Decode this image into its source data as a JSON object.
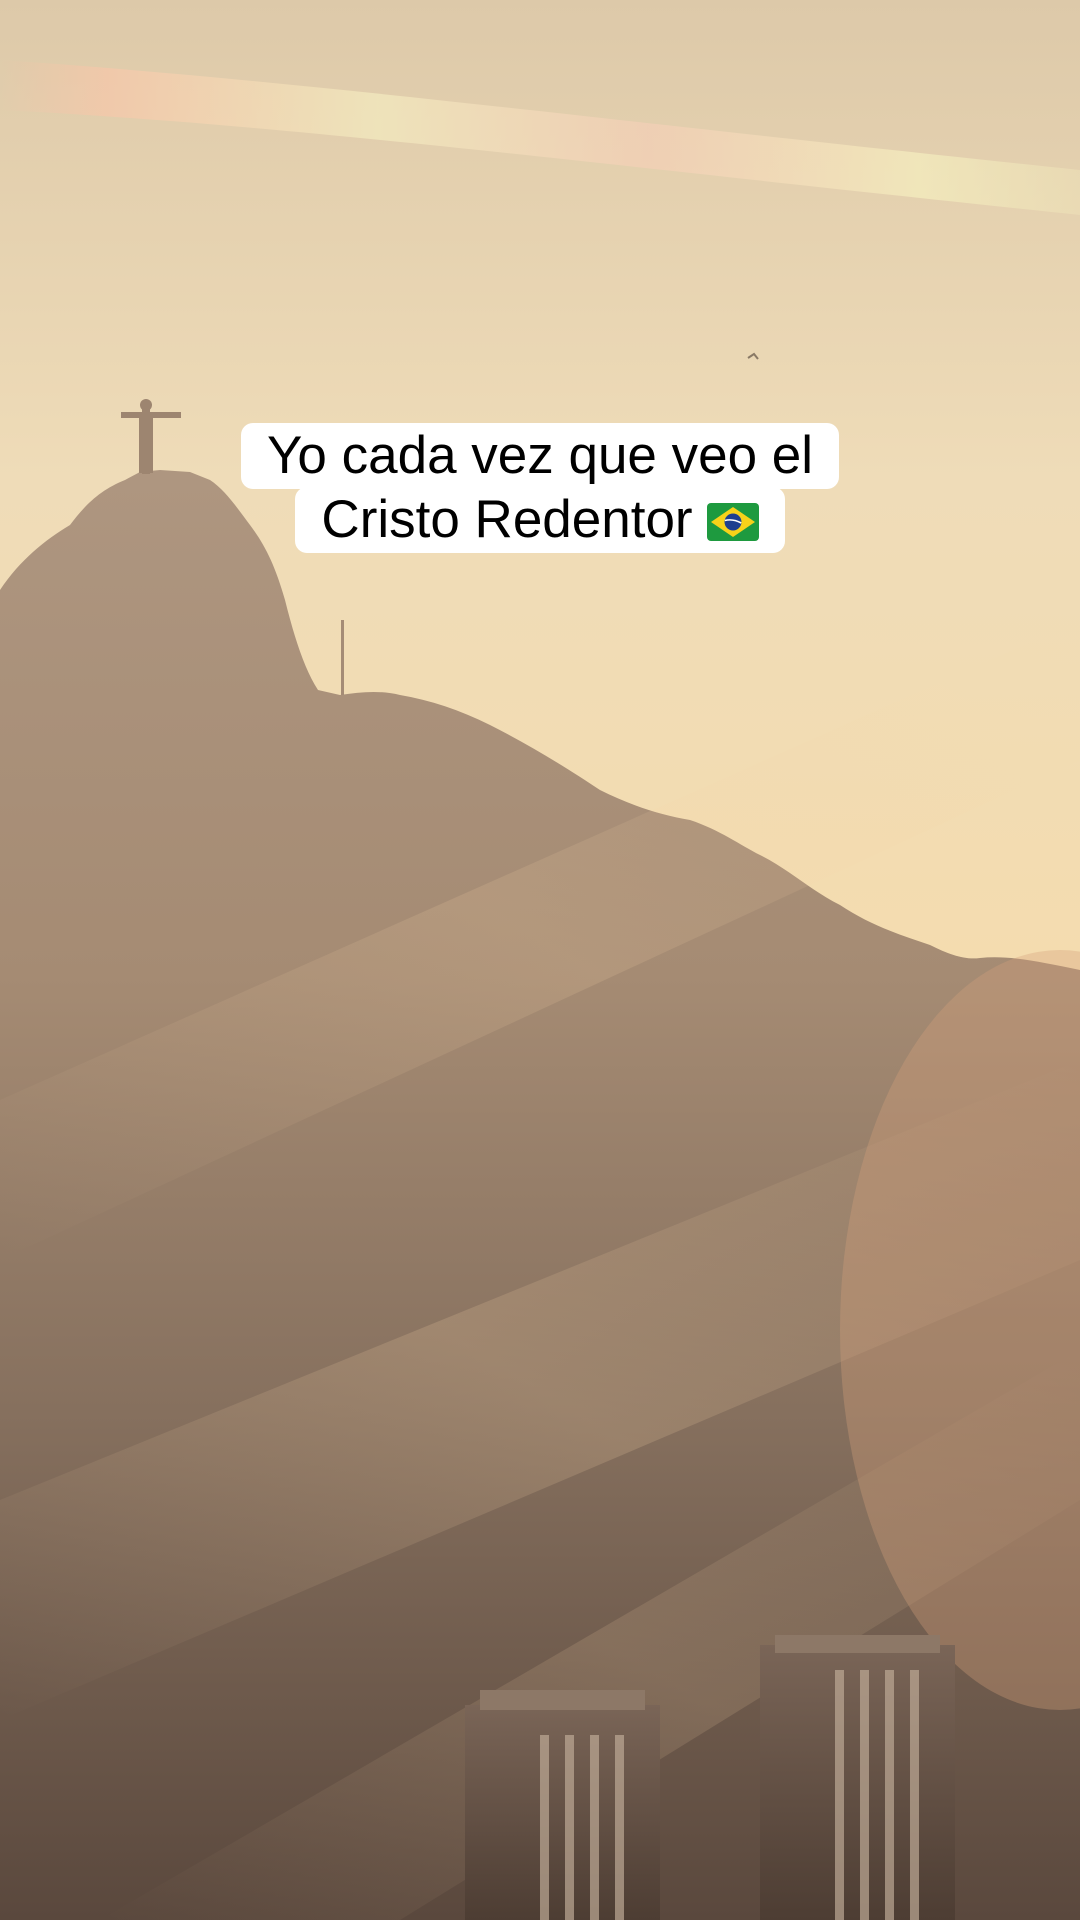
{
  "video": {
    "scene_description_icon": "rio-corcovado-sunset-scene",
    "colors": {
      "sky_top": "#e7d6b6",
      "sky_mid": "#f2ddb3",
      "sky_low": "#f3d3a0",
      "mountain": "#a98e77",
      "mist_bottom": "#5e4b3f",
      "caption_bg": "#ffffff",
      "caption_text": "#000000"
    }
  },
  "caption": {
    "line1": "Yo cada vez que veo el",
    "line2": "Cristo Redentor",
    "emoji_icon": "brazil-flag-icon"
  }
}
